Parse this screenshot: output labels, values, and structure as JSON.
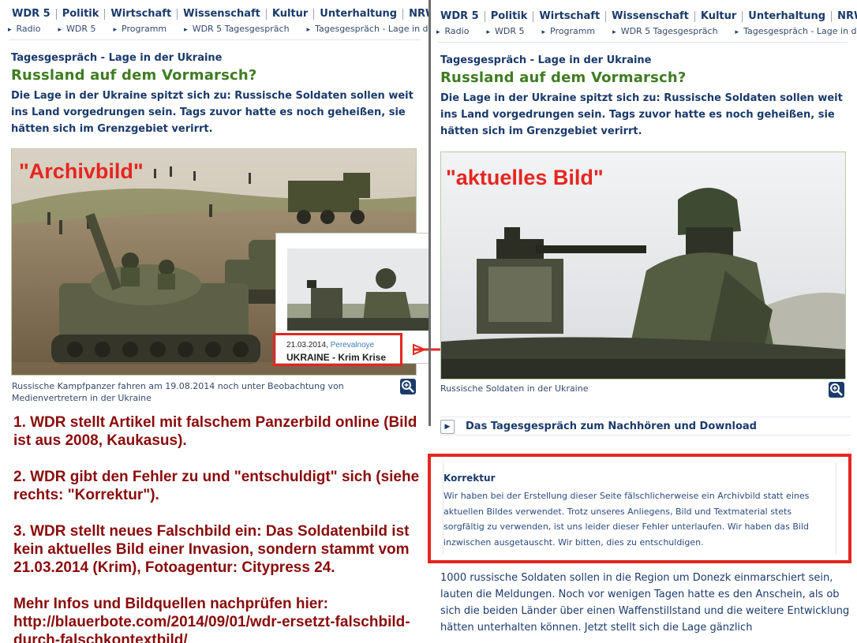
{
  "nav_items": [
    "WDR 5",
    "Politik",
    "Wirtschaft",
    "Wissenschaft",
    "Kultur",
    "Unterhaltung",
    "NRW"
  ],
  "breadcrumb": [
    "Radio",
    "WDR 5",
    "Programm",
    "WDR 5 Tagesgespräch",
    "Tagesgespräch - Lage in der Ukraine"
  ],
  "article": {
    "kicker": "Tagesgespräch - Lage in der Ukraine",
    "headline": "Russland auf dem Vormarsch?",
    "teaser": "Die Lage in der Ukraine spitzt sich zu: Russische Soldaten sollen weit ins Land vorgedrungen sein. Tags zuvor hatte es noch geheißen, sie hätten sich im Grenzgebiet verirrt."
  },
  "left": {
    "image_label": "\"Archivbild\"",
    "caption": "Russische Kampfpanzer fahren am 19.08.2014 noch unter Beobachtung von Medienvertretern in der Ukraine",
    "inset": {
      "date": "21.03.2014,",
      "location": "Perevalnoye",
      "title": "UKRAINE - Krim Krise"
    },
    "notes": [
      "1. WDR stellt Artikel mit falschem Panzerbild online (Bild ist aus 2008, Kaukasus).",
      "2. WDR gibt den Fehler zu und \"entschuldigt\" sich (siehe rechts: \"Korrektur\").",
      "3. WDR stellt neues Falschbild ein: Das Soldatenbild ist kein aktuelles Bild einer Invasion, sondern stammt vom 21.03.2014 (Krim), Fotoagentur: Citypress 24.",
      "Mehr Infos und Bildquellen nachprüfen hier: http://blauerbote.com/2014/09/01/wdr-ersetzt-falschbild-durch-falschkontextbild/"
    ]
  },
  "right": {
    "image_label": "\"aktuelles Bild\"",
    "caption": "Russische Soldaten in der Ukraine",
    "audio_link": "Das Tagesgespräch zum Nachhören und Download",
    "korrektur": {
      "title": "Korrektur",
      "text": "Wir haben bei der Erstellung dieser Seite fälschlicherweise ein Archivbild statt eines aktuellen Bildes verwendet. Trotz unseres Anliegens, Bild und Textmaterial stets sorgfältig zu verwenden, ist uns leider dieser Fehler unterlaufen. Wir haben das Bild inzwischen ausgetauscht. Wir bitten, dies zu entschuldigen."
    },
    "body": "1000 russische Soldaten sollen in die Region um Donezk einmarschiert sein, lauten die Meldungen. Noch vor wenigen Tagen hatte es den Anschein, als ob sich die beiden Länder über einen Waffenstillstand und die weitere Entwicklung hätten unterhalten können. Jetzt stellt sich die Lage gänzlich"
  },
  "colors": {
    "nav_text": "#1a3a6b",
    "headline": "#3f7c22",
    "annotation_red": "#e52620",
    "notes_text": "#8a0b0b"
  },
  "icons": [
    "zoom-icon",
    "play-icon",
    "arrow-right-icon"
  ]
}
